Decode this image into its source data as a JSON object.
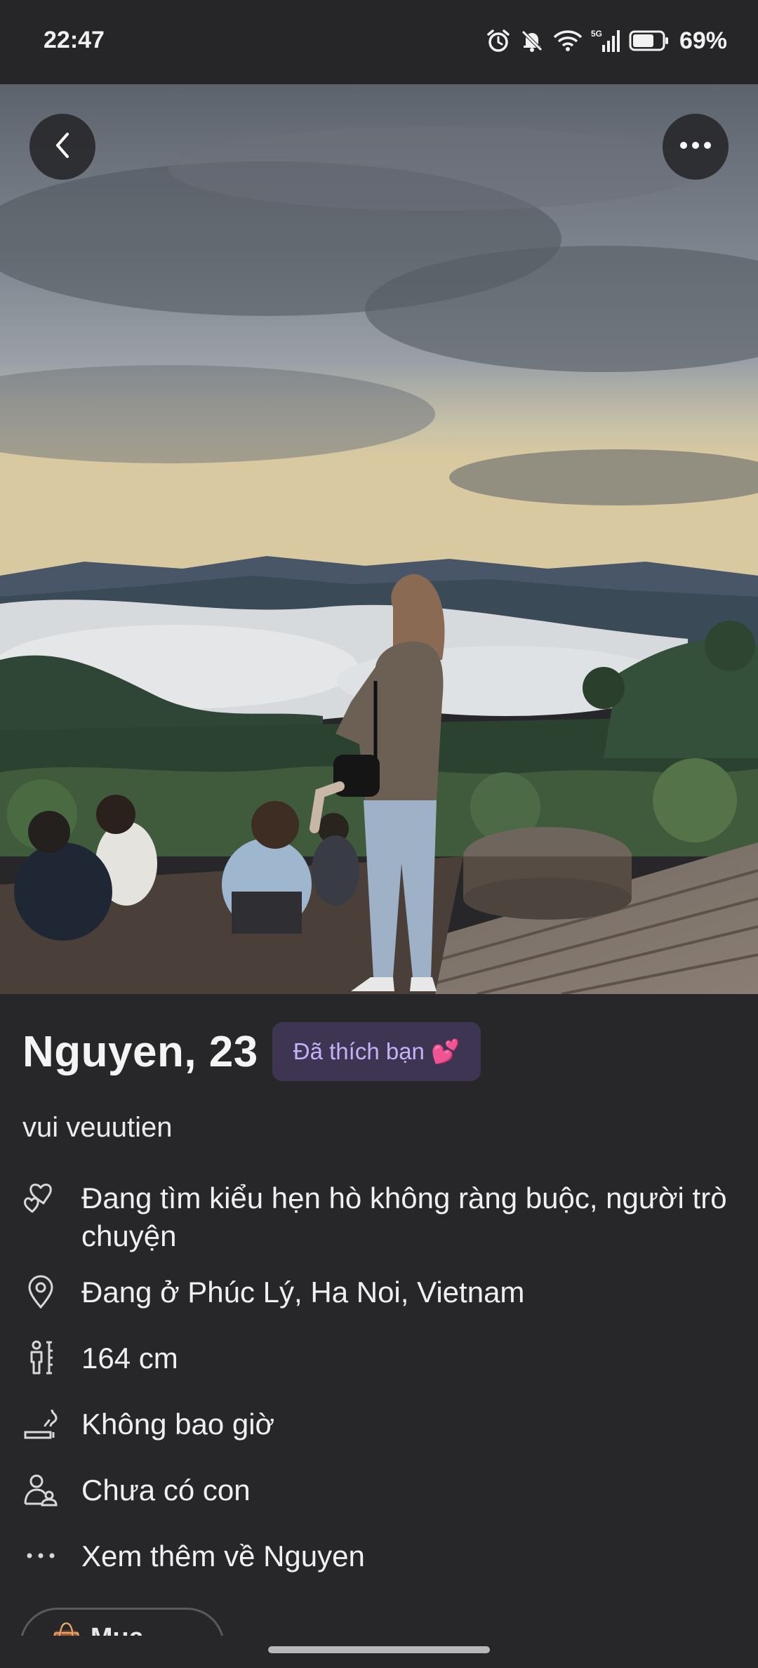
{
  "status_bar": {
    "time": "22:47",
    "battery": "69%",
    "icons": [
      "alarm-icon",
      "bell-off-icon",
      "wifi-icon",
      "signal-5g-icon",
      "battery-icon"
    ]
  },
  "photo": {
    "back_icon": "chevron-left-icon",
    "more_icon": "more-horizontal-icon"
  },
  "profile": {
    "name_age": "Nguyen, 23",
    "liked_badge": "Đã thích bạn 💕",
    "bio": "vui veuutien",
    "details": [
      {
        "icon": "hearts-icon",
        "text": "Đang tìm kiểu hẹn hò không ràng buộc, người trò chuyện"
      },
      {
        "icon": "location-pin-icon",
        "text": "Đang ở Phúc Lý, Ha Noi, Vietnam"
      },
      {
        "icon": "height-icon",
        "text": "164 cm"
      },
      {
        "icon": "smoking-icon",
        "text": "Không bao giờ"
      },
      {
        "icon": "children-icon",
        "text": "Chưa có con"
      },
      {
        "icon": "more-dots-icon",
        "text": "Xem thêm về Nguyen"
      }
    ],
    "chip_peek": "👜 Mua sắm"
  },
  "colors": {
    "background": "#27272a",
    "badge_bg": "#3d3552",
    "badge_text": "#c4b1f7"
  }
}
